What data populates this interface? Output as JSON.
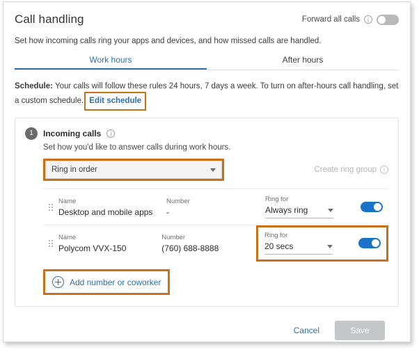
{
  "header": {
    "title": "Call handling",
    "forward_all_calls_label": "Forward all calls",
    "forward_all_calls_state": "off",
    "info_icon": "info-icon",
    "subtitle": "Set how incoming calls ring your apps and devices, and how missed calls are handled."
  },
  "tabs": [
    {
      "label": "Work hours",
      "active": true
    },
    {
      "label": "After hours",
      "active": false
    }
  ],
  "schedule": {
    "prefix_label": "Schedule:",
    "text": " Your calls will follow these rules 24 hours, 7 days a week. To turn on after-hours call handling, set a custom schedule.",
    "edit_link": "Edit schedule"
  },
  "card": {
    "step_number": "1",
    "title": "Incoming calls",
    "info_icon": "info-icon",
    "subtitle": "Set how you'd like to answer calls during work hours.",
    "mode_select": {
      "value": "Ring in order",
      "caret_icon": "chevron-down-icon"
    },
    "create_ring_group": {
      "label": "Create ring group",
      "disabled": true,
      "info_icon": "info-icon"
    },
    "columns": {
      "name": "Name",
      "number": "Number",
      "ring_for": "Ring for"
    },
    "rows": [
      {
        "drag_icon": "drag-handle-icon",
        "name": "Desktop and mobile apps",
        "number": "-",
        "ring_for": "Always ring",
        "caret_icon": "chevron-down-icon",
        "toggle_state": "on",
        "highlighted": false
      },
      {
        "drag_icon": "drag-handle-icon",
        "name": "Polycom VVX-150",
        "number": "(760) 688-8888",
        "ring_for": "20 secs",
        "caret_icon": "chevron-down-icon",
        "toggle_state": "on",
        "highlighted": true
      }
    ],
    "add_link": {
      "label": "Add number or coworker",
      "icon": "plus-circle-icon"
    }
  },
  "footer": {
    "cancel_label": "Cancel",
    "save_label": "Save"
  },
  "colors": {
    "accent_blue": "#2f6fa8",
    "toggle_on": "#1a73c7",
    "toggle_off": "#b9b9b9",
    "highlight_orange": "#c8711a",
    "save_disabled": "#c4c6c8"
  }
}
